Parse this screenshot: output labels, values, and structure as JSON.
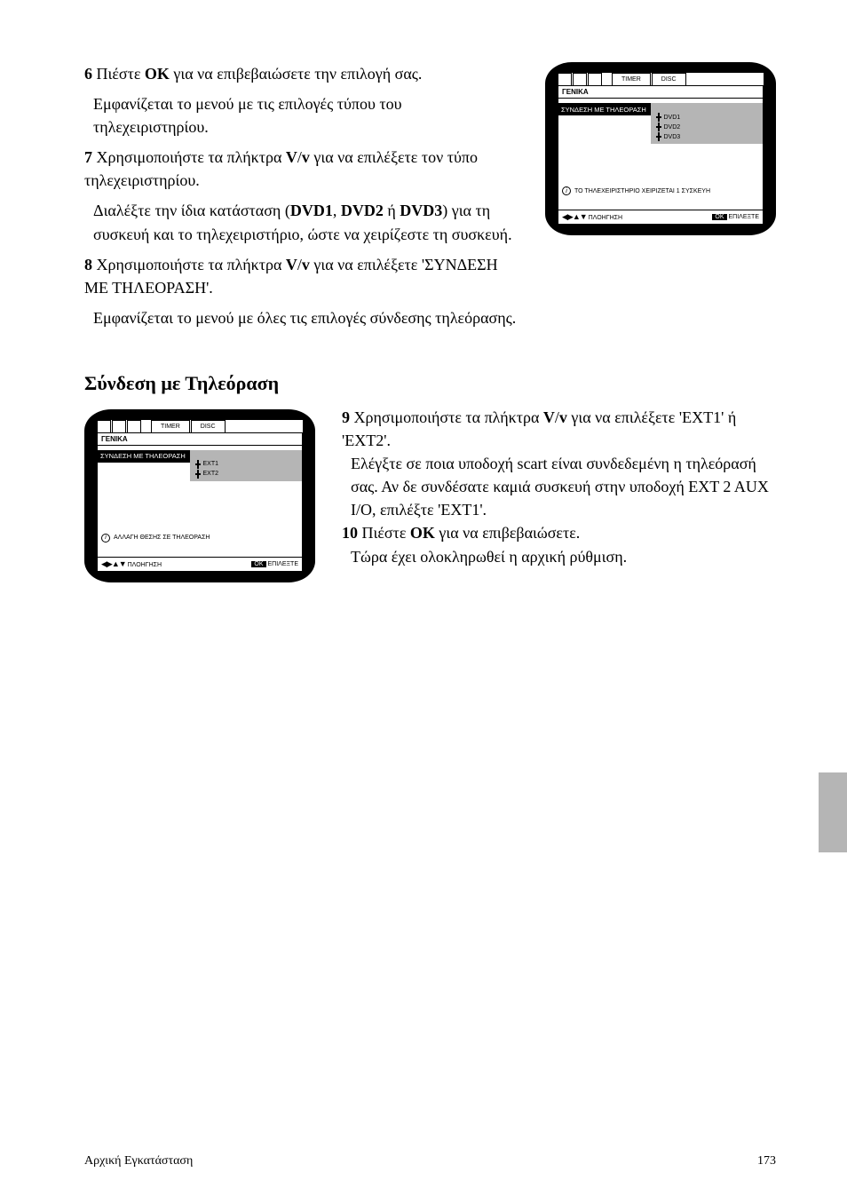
{
  "section1": {
    "step_prefix": "6 ",
    "step_text_a": "Πιέστε ",
    "step_btn": "OK",
    "step_text_b": " για να επιβεβαιώσετε την επιλογή σας.",
    "para2": "Εμφανίζεται το μενού με τις επιλογές τύπου του τηλεχειριστηρίου.",
    "step7_prefix": "7 ",
    "step7_a": "Χρησιμοποιήστε τα πλήκτρα ",
    "step7_btn1": "V",
    "step7_mid": "/",
    "step7_btn2": "v",
    "step7_b": " για να επιλέξετε τον τύπο τηλεχειριστηρίου.",
    "para4_a": "Διαλέξτε την ίδια κατάσταση (",
    "para4_dvd1": "DVD1",
    "para4_b": ", ",
    "para4_dvd2": "DVD2",
    "para4_c": " ή ",
    "para4_dvd3": "DVD3",
    "para4_d": ") για τη συσκευή και το τηλεχειριστήριο, ώστε να χειρίζεστε τη συσκευή.",
    "step8_prefix": "8 ",
    "step8_a": "Χρησιμοποιήστε τα πλήκτρα ",
    "step8_btn1": "V",
    "step8_mid": "/",
    "step8_btn2": "v",
    "step8_b": " για να επιλέξετε 'ΣΥΝΔΕΣΗ ΜΕ ΤΗΛΕΟΡΑΣΗ'.",
    "para6": "Εμφανίζεται το μενού με όλες τις επιλογές σύνδεσης τηλεόρασης.",
    "heading": "Σύνδεση με Τηλεόραση"
  },
  "tv1": {
    "tabs": [
      "",
      "",
      "",
      "TIMER",
      "DISC"
    ],
    "header": "ΓΕΝΙΚΑ",
    "sel_label": "ΣΥΝΔΕΣΗ ΜΕ ΤΗΛΕΟΡΑΣΗ",
    "opts": [
      "DVD1",
      "DVD2",
      "DVD3"
    ],
    "info": "ΤΟ ΤΗΛΕΧΕΙΡΙΣΤΗΡΙΟ ΧΕΙΡΙΖΕΤΑΙ 1 ΣΥΣΚΕΥΗ",
    "footer_left": "ΠΛΟΗΓΗΣΗ",
    "footer_ok": "OK",
    "footer_right": "ΕΠΙΛΕΞΤΕ"
  },
  "tv2": {
    "tabs": [
      "",
      "",
      "",
      "TIMER",
      "DISC"
    ],
    "header": "ΓΕΝΙΚΑ",
    "sel_label": "ΣΥΝΔΕΣΗ ΜΕ ΤΗΛΕΟΡΑΣΗ",
    "opts": [
      "EXT1",
      "EXT2"
    ],
    "info": "ΑΛΛΑΓΗ ΘΕΣΗΣ ΣΕ ΤΗΛΕΟΡΑΣΗ",
    "footer_left": "ΠΛΟΗΓΗΣΗ",
    "footer_ok": "OK",
    "footer_right": "ΕΠΙΛΕΞΤΕ"
  },
  "section2": {
    "step9_prefix": "9 ",
    "step9_a": "Χρησιμοποιήστε τα πλήκτρα ",
    "step9_btn1": "V",
    "step9_mid": "/",
    "step9_btn2": "v",
    "step9_b": " για να επιλέξετε 'EXT1' ή 'EXT2'.",
    "para": "Ελέγξτε σε ποια υποδοχή scart είναι συνδεδεμένη η τηλεόρασή σας. Αν δε συνδέσατε καμιά συσκευή στην υποδοχή EXT 2 AUX I/O, επιλέξτε 'EXT1'.",
    "step10_prefix": "10 ",
    "step10_a": "Πιέστε ",
    "step10_btn": "OK",
    "step10_b": " για να επιβεβαιώσετε.",
    "end": "Τώρα έχει ολοκληρωθεί η αρχική ρύθμιση."
  },
  "footer": {
    "left": "Αρχική Εγκατάσταση",
    "right": "173"
  }
}
